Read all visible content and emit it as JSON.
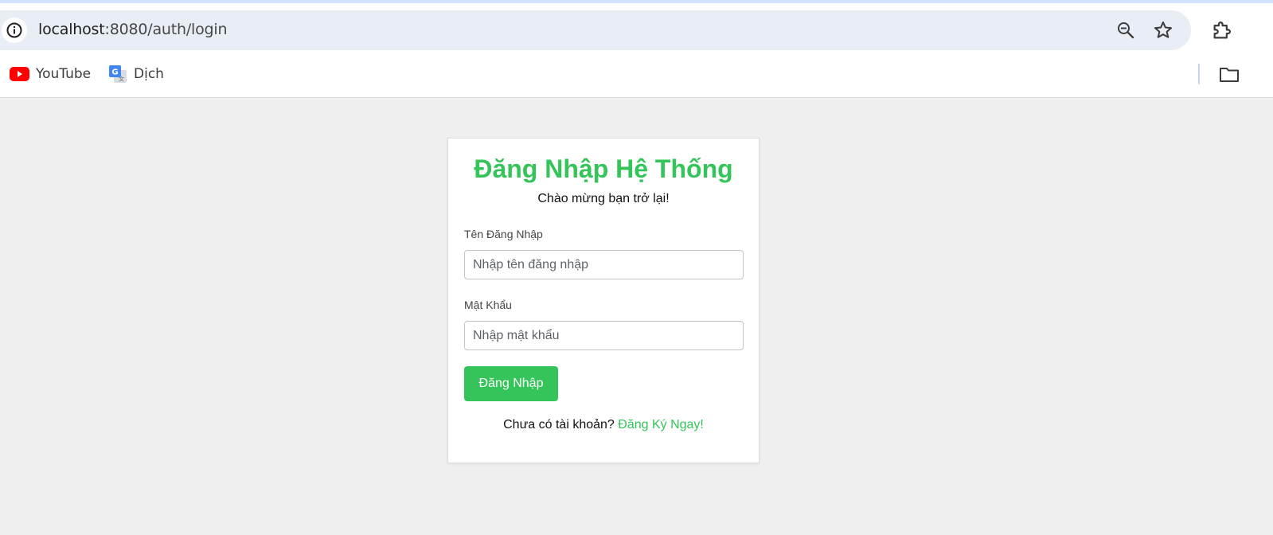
{
  "browser": {
    "url_host": "localhost",
    "url_path": ":8080/auth/login",
    "bookmarks": [
      {
        "label": "YouTube",
        "icon": "youtube-icon"
      },
      {
        "label": "Dịch",
        "icon": "google-translate-icon"
      }
    ]
  },
  "login": {
    "title": "Đăng Nhập Hệ Thống",
    "subtitle": "Chào mừng bạn trở lại!",
    "username_label": "Tên Đăng Nhập",
    "username_placeholder": "Nhập tên đăng nhập",
    "username_value": "",
    "password_label": "Mật Khẩu",
    "password_placeholder": "Nhập mật khẩu",
    "password_value": "",
    "submit_label": "Đăng Nhập",
    "register_prompt": "Chưa có tài khoản?",
    "register_link": "Đăng Ký Ngay!"
  },
  "colors": {
    "accent": "#34c459",
    "page_bg": "#efefef",
    "omnibox_bg": "#e9eef6"
  }
}
